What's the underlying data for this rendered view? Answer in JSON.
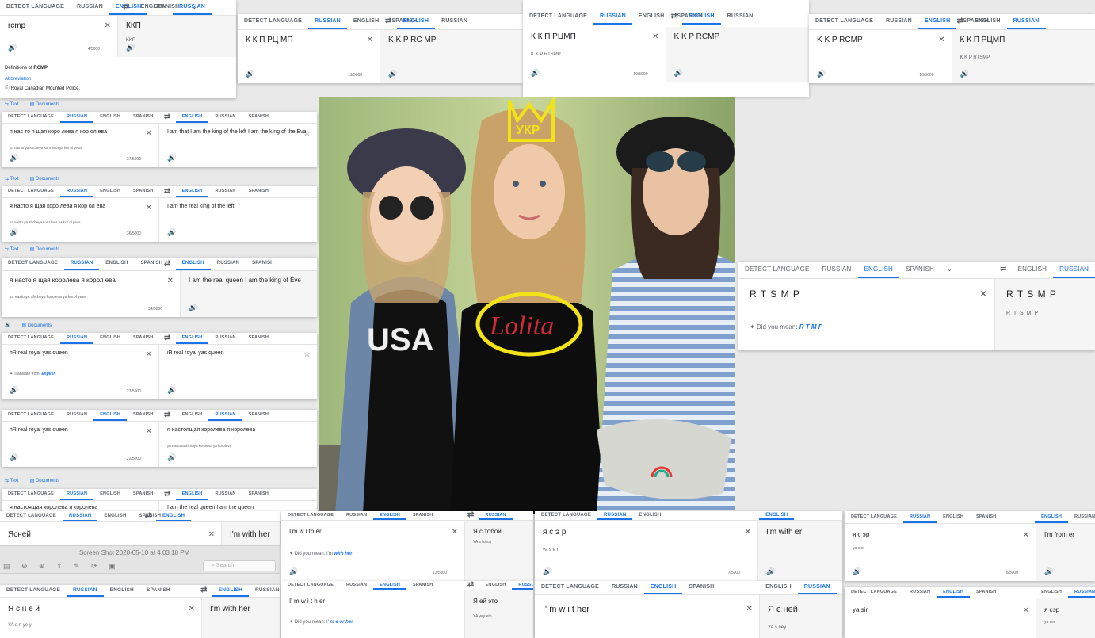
{
  "langs": {
    "detect": "DETECT LANGUAGE",
    "russian": "RUSSIAN",
    "english": "ENGLISH",
    "spanish": "SPANISH"
  },
  "panels": {
    "p1": {
      "src": "rcmp",
      "tgt": "ККП",
      "tgt_small": "KKP",
      "count": "4/5000",
      "def_title_a": "Definitions of ",
      "def_title_b": "RCMP",
      "def_pos": "Abbreviation",
      "def_text": "Royal Canadian Mounted Police."
    },
    "p2": {
      "src": "К К П РЦ МП",
      "tgt": "K K P RC MP",
      "count": "11/5000"
    },
    "p3": {
      "src": "К К П РЦМП",
      "src_small": "K K P RTSMP",
      "tgt": "K K P RCMP",
      "count": "10/5000"
    },
    "p4": {
      "src": "K K P RCMP",
      "tgt": "К К П РЦМП",
      "tgt_small": "K K P RTSMP",
      "count": "10/5000"
    },
    "p5": {
      "src": "я нас то я щая коро лева я кор ол ева",
      "src_small": "ya nas to ya shcheya koro leva ya kor ol yeva",
      "tgt": "I am that I am the king of the left I am the king of the Eva",
      "count": "37/5000"
    },
    "p6": {
      "src": "я насто я щая коро лева я кор ол ева",
      "src_small": "ya nasto ya shcheya koro leva ya kor ol yeva",
      "tgt": "I am the real king of the left",
      "count": "36/5000"
    },
    "p7": {
      "src": "я насто я щая королева я корол ева",
      "src_small": "ya nasto ya shcheya koroleva ya korol yeva",
      "tgt": "I am the real queen I am the king of Eve",
      "count": "34/5000"
    },
    "p8": {
      "src": "яR real royal yas queen",
      "tgt": "iR real royal yas queen",
      "hint_a": "Translate from: ",
      "hint_b": "English",
      "count": "23/5000"
    },
    "p9": {
      "src": "яR real royal yas queen",
      "tgt": "я настоящая королева я королева",
      "tgt_small": "ya nastoyashchaya koroleva ya koroleva",
      "count": "22/5000"
    },
    "p10": {
      "src": "я настоящая королева я королева",
      "tgt": "I am the real queen I am the queen"
    },
    "p11": {
      "src": "Ясней",
      "tgt": "I'm with her"
    },
    "p12": {
      "src": "Я с н е й",
      "src_small": "YA s n ye y",
      "tgt": "I'm with her"
    },
    "p13": {
      "src": "I'm w i th er",
      "dym_a": "Did you mean: I'm ",
      "dym_b": "with her",
      "tgt": "Я с тобой",
      "tgt_small": "YA s toboy",
      "count": "13/5000"
    },
    "p14": {
      "src": "I' m w i t h er",
      "dym_a": "Did you mean: I' ",
      "dym_b": "m e or her",
      "tgt": "Я ей это",
      "tgt_small": "YA yey eto"
    },
    "p15": {
      "src": "я с э р",
      "src_small": "ya s e r",
      "tgt": "I'm with er",
      "count": "7/5000"
    },
    "p16": {
      "src": "I' m w i t her",
      "tgt": "Я с ней",
      "tgt_small": "YA s ney"
    },
    "p17": {
      "src": "я с эр",
      "src_small": "ya s er",
      "tgt": "I'm from er",
      "count": "6/5000"
    },
    "p18": {
      "src": "ya sir",
      "tgt": "я сэр",
      "tgt_small": "ya ser"
    },
    "p19": {
      "src": "R T S M P",
      "dym_a": "Did you mean: ",
      "dym_b": "R T M P",
      "tgt": "R T S M P",
      "tgt_small": "R T S M P"
    }
  },
  "tabs": {
    "text": "Text",
    "documents": "Documents"
  },
  "mac": {
    "title": "Screen Shot 2020-05-10 at 4.03.18 PM",
    "search_placeholder": "Search"
  },
  "photo": {
    "shirt_text": "Lolita",
    "crown_text": "УКР",
    "tshirt_left": "USA"
  }
}
